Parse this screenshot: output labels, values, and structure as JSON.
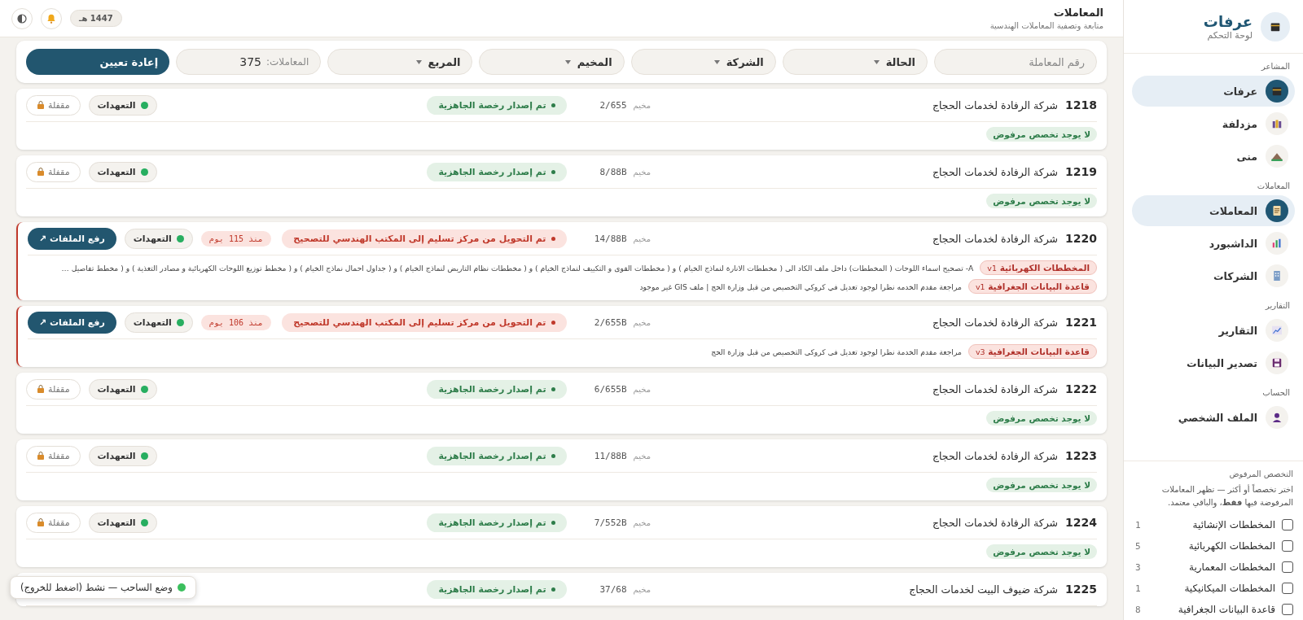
{
  "header": {
    "title": "المعاملات",
    "subtitle": "متابعة وتصفية المعاملات الهندسية",
    "year": "1447 هـ"
  },
  "filters": {
    "fields": [
      {
        "kind": "input",
        "placeholder": "رقم المعاملة"
      },
      {
        "kind": "select",
        "label": "الحالة"
      },
      {
        "kind": "select",
        "label": "الشركة"
      },
      {
        "kind": "select",
        "label": "المخيم"
      },
      {
        "kind": "select",
        "label": "المربع"
      }
    ],
    "count_label": "المعاملات:",
    "count": "375",
    "reset": "إعادة تعيين"
  },
  "rows": [
    {
      "number": "1218",
      "company": "شركة الرفادة لخدمات الحجاج",
      "camp_label": "مخيم",
      "camp": "2/655",
      "status": {
        "kind": "done",
        "text": "تم إصدار رخصة الجاهزية"
      },
      "pledges": "التعهدات",
      "action": {
        "kind": "locked",
        "label": "مقفلة"
      },
      "empty_note": "لا يوجد تخصص مرفوض"
    },
    {
      "number": "1219",
      "company": "شركة الرفادة لخدمات الحجاج",
      "camp_label": "مخيم",
      "camp": "8/88B",
      "status": {
        "kind": "done",
        "text": "تم إصدار رخصة الجاهزية"
      },
      "pledges": "التعهدات",
      "action": {
        "kind": "locked",
        "label": "مقفلة"
      },
      "empty_note": "لا يوجد تخصص مرفوض"
    },
    {
      "number": "1220",
      "company": "شركة الرفادة لخدمات الحجاج",
      "camp_label": "مخيم",
      "camp": "14/88B",
      "status": {
        "kind": "returned",
        "text": "تم التحويل من مركز تسليم إلى المكتب الهندسي للتصحيح"
      },
      "age": "منذ 115 يوم",
      "pledges": "التعهدات",
      "action": {
        "kind": "upload",
        "label": "رفع الملفات ↗"
      },
      "notes": [
        {
          "tag": "المخططات الكهربائية",
          "version": "v1",
          "text": "A- تصحيح اسماء اللوحات ( المخططات) داخل ملف الكاد الى ( مخططات الانارة لنماذج الخيام ) و ( مخططات القوى و التكييف لنماذج الخيام ) و ( مخططات نظام التاريض لنماذج الخيام ) و ( جداول احمال نماذج الخيام ) و ( مخطط توزيع اللوحات الكهربائية و مصادر التغذية ) و ( مخطط تفاصيل …"
        },
        {
          "tag": "قاعدة البيانات الجغرافية",
          "version": "v1",
          "text": "مراجعة مقدم الخدمه نظرا لوجود تعديل في كروكي التخصيص من قبل وزارة الحج | ملف GIS غير موجود"
        }
      ]
    },
    {
      "number": "1221",
      "company": "شركة الرفادة لخدمات الحجاج",
      "camp_label": "مخيم",
      "camp": "2/655B",
      "status": {
        "kind": "returned",
        "text": "تم التحويل من مركز تسليم إلى المكتب الهندسي للتصحيح"
      },
      "age": "منذ 106 يوم",
      "pledges": "التعهدات",
      "action": {
        "kind": "upload",
        "label": "رفع الملفات ↗"
      },
      "notes": [
        {
          "tag": "قاعدة البيانات الجغرافية",
          "version": "v3",
          "text": "مراجعة مقدم الخدمة نظرا لوجود تعديل فى كروكى التخصيص من قبل وزارة الحج"
        }
      ]
    },
    {
      "number": "1222",
      "company": "شركة الرفادة لخدمات الحجاج",
      "camp_label": "مخيم",
      "camp": "6/655B",
      "status": {
        "kind": "done",
        "text": "تم إصدار رخصة الجاهزية"
      },
      "pledges": "التعهدات",
      "action": {
        "kind": "locked",
        "label": "مقفلة"
      },
      "empty_note": "لا يوجد تخصص مرفوض"
    },
    {
      "number": "1223",
      "company": "شركة الرفادة لخدمات الحجاج",
      "camp_label": "مخيم",
      "camp": "11/88B",
      "status": {
        "kind": "done",
        "text": "تم إصدار رخصة الجاهزية"
      },
      "pledges": "التعهدات",
      "action": {
        "kind": "locked",
        "label": "مقفلة"
      },
      "empty_note": "لا يوجد تخصص مرفوض"
    },
    {
      "number": "1224",
      "company": "شركة الرفادة لخدمات الحجاج",
      "camp_label": "مخيم",
      "camp": "7/552B",
      "status": {
        "kind": "done",
        "text": "تم إصدار رخصة الجاهزية"
      },
      "pledges": "التعهدات",
      "action": {
        "kind": "locked",
        "label": "مقفلة"
      },
      "empty_note": "لا يوجد تخصص مرفوض"
    },
    {
      "number": "1225",
      "company": "شركة ضيوف البيت لخدمات الحجاج",
      "camp_label": "مخيم",
      "camp": "37/68",
      "status": {
        "kind": "done",
        "text": "تم إصدار رخصة الجاهزية"
      }
    }
  ],
  "toast": "وضع الساحب — نشط (اضغط للخروج)",
  "sidebar": {
    "brand": {
      "title": "عرفات",
      "subtitle": "لوحة التحكم"
    },
    "sections": [
      {
        "title": "المشاعر",
        "items": [
          {
            "label": "عرفات",
            "selected": true
          },
          {
            "label": "مزدلفة",
            "selected": false
          },
          {
            "label": "منى",
            "selected": false
          }
        ]
      },
      {
        "title": "المعاملات",
        "items": [
          {
            "label": "المعاملات",
            "selected": true
          },
          {
            "label": "الداشبورد",
            "selected": false
          },
          {
            "label": "الشركات",
            "selected": false
          }
        ]
      },
      {
        "title": "التقارير",
        "items": [
          {
            "label": "التقارير",
            "selected": false
          },
          {
            "label": "تصدير البيانات",
            "selected": false
          }
        ]
      },
      {
        "title": "الحساب",
        "items": [
          {
            "label": "الملف الشخصي",
            "selected": false
          }
        ]
      }
    ],
    "rejected_filter": {
      "title": "التخصص المرفوض",
      "description": "اختر تخصصاً أو أكثر — تظهر المعاملات المرفوضة فيها **فقط**، والباقي معتمد.",
      "options": [
        {
          "label": "المخططات الإنشائية",
          "count": "1",
          "checked": false
        },
        {
          "label": "المخططات الكهربائية",
          "count": "5",
          "checked": false
        },
        {
          "label": "المخططات المعمارية",
          "count": "3",
          "checked": false
        },
        {
          "label": "المخططات الميكانيكية",
          "count": "1",
          "checked": false
        },
        {
          "label": "قاعدة البيانات الجغرافية",
          "count": "8",
          "checked": false
        }
      ]
    }
  }
}
